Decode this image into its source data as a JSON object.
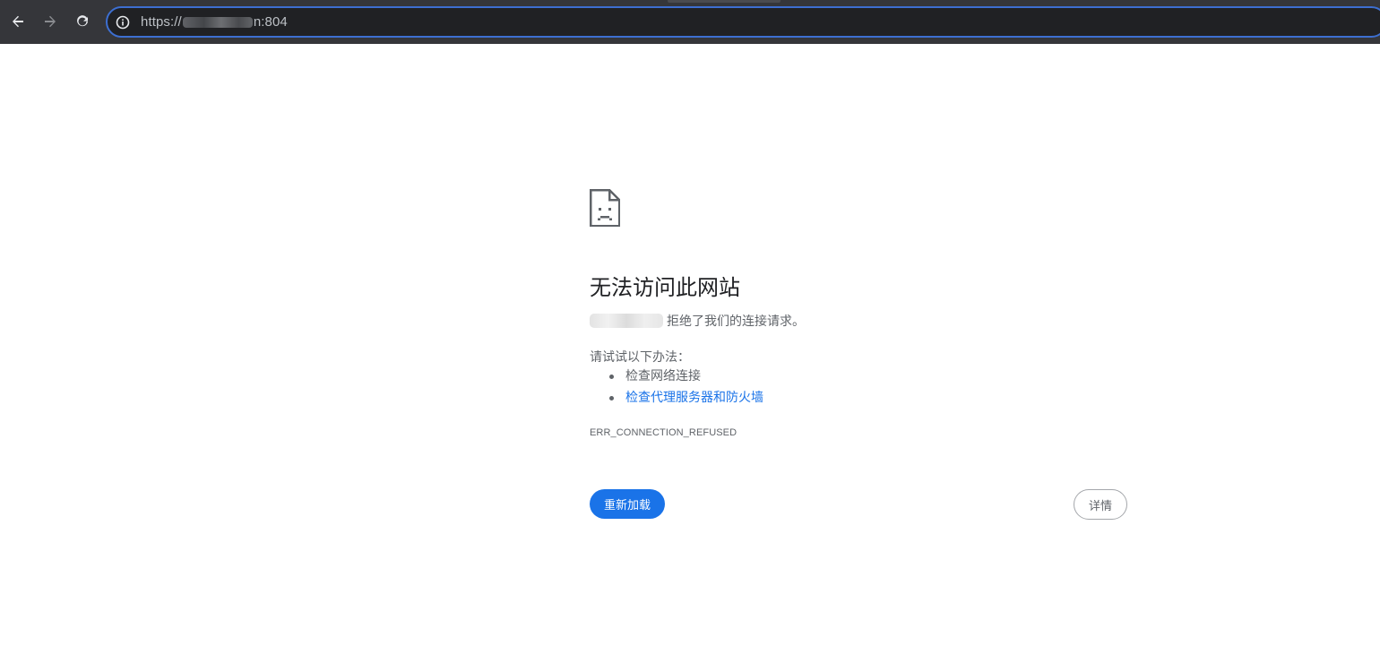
{
  "toolbar": {
    "back_icon": "arrow-left-icon",
    "forward_icon": "arrow-right-icon",
    "reload_icon": "reload-icon",
    "site_info_icon": "info-circle-icon",
    "url_prefix": "https://",
    "url_suffix": "n:804"
  },
  "error": {
    "icon": "sad-page-icon",
    "headline": "无法访问此网站",
    "summary_text": "拒绝了我们的连接请求。",
    "suggestions_label": "请试试以下办法：",
    "suggestions": [
      {
        "text": "检查网络连接",
        "link": false
      },
      {
        "text": "检查代理服务器和防火墙",
        "link": true
      }
    ],
    "error_code": "ERR_CONNECTION_REFUSED",
    "reload_label": "重新加载",
    "details_label": "详情"
  },
  "colors": {
    "toolbar_bg": "#35363a",
    "omnibox_bg": "#202124",
    "omnibox_focus": "#3d6fd1",
    "primary_blue": "#1a73e8",
    "text_primary": "#202124",
    "text_secondary": "#5f6368"
  }
}
